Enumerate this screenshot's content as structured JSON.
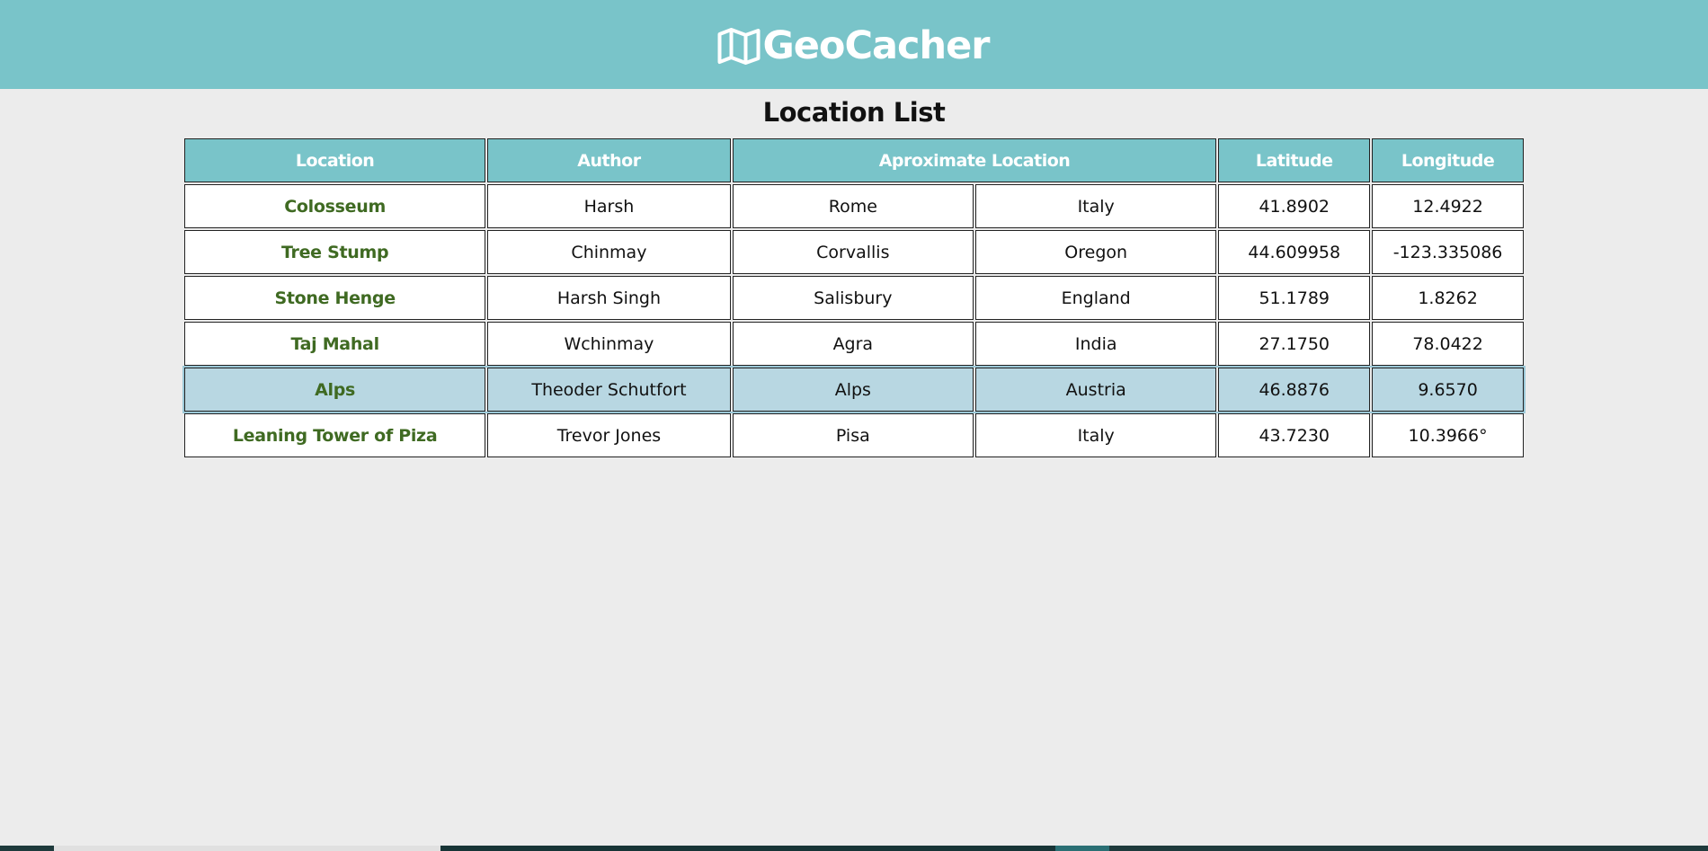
{
  "header": {
    "brand": "GeoCacher",
    "brand_icon": "map-icon",
    "color": "#79c4c9"
  },
  "page": {
    "title": "Location List"
  },
  "table": {
    "headers": {
      "location": "Location",
      "author": "Author",
      "approx_location": "Aproximate Location",
      "latitude": "Latitude",
      "longitude": "Longitude"
    },
    "rows": [
      {
        "location": "Colosseum",
        "author": "Harsh",
        "city": "Rome",
        "region": "Italy",
        "latitude": "41.8902",
        "longitude": "12.4922"
      },
      {
        "location": "Tree Stump",
        "author": "Chinmay",
        "city": "Corvallis",
        "region": "Oregon",
        "latitude": "44.609958",
        "longitude": "-123.335086"
      },
      {
        "location": "Stone Henge",
        "author": "Harsh Singh",
        "city": "Salisbury",
        "region": "England",
        "latitude": "51.1789",
        "longitude": "1.8262"
      },
      {
        "location": "Taj Mahal",
        "author": "Wchinmay",
        "city": "Agra",
        "region": "India",
        "latitude": "27.1750",
        "longitude": "78.0422"
      },
      {
        "location": "Alps",
        "author": "Theoder Schutfort",
        "city": "Alps",
        "region": "Austria",
        "latitude": "46.8876",
        "longitude": "9.6570"
      },
      {
        "location": "Leaning Tower of Piza",
        "author": "Trevor Jones",
        "city": "Pisa",
        "region": "Italy",
        "latitude": "43.7230",
        "longitude": "10.3966°"
      }
    ],
    "highlight_color": "#b8d7e2",
    "location_text_color": "#3f6a22"
  }
}
